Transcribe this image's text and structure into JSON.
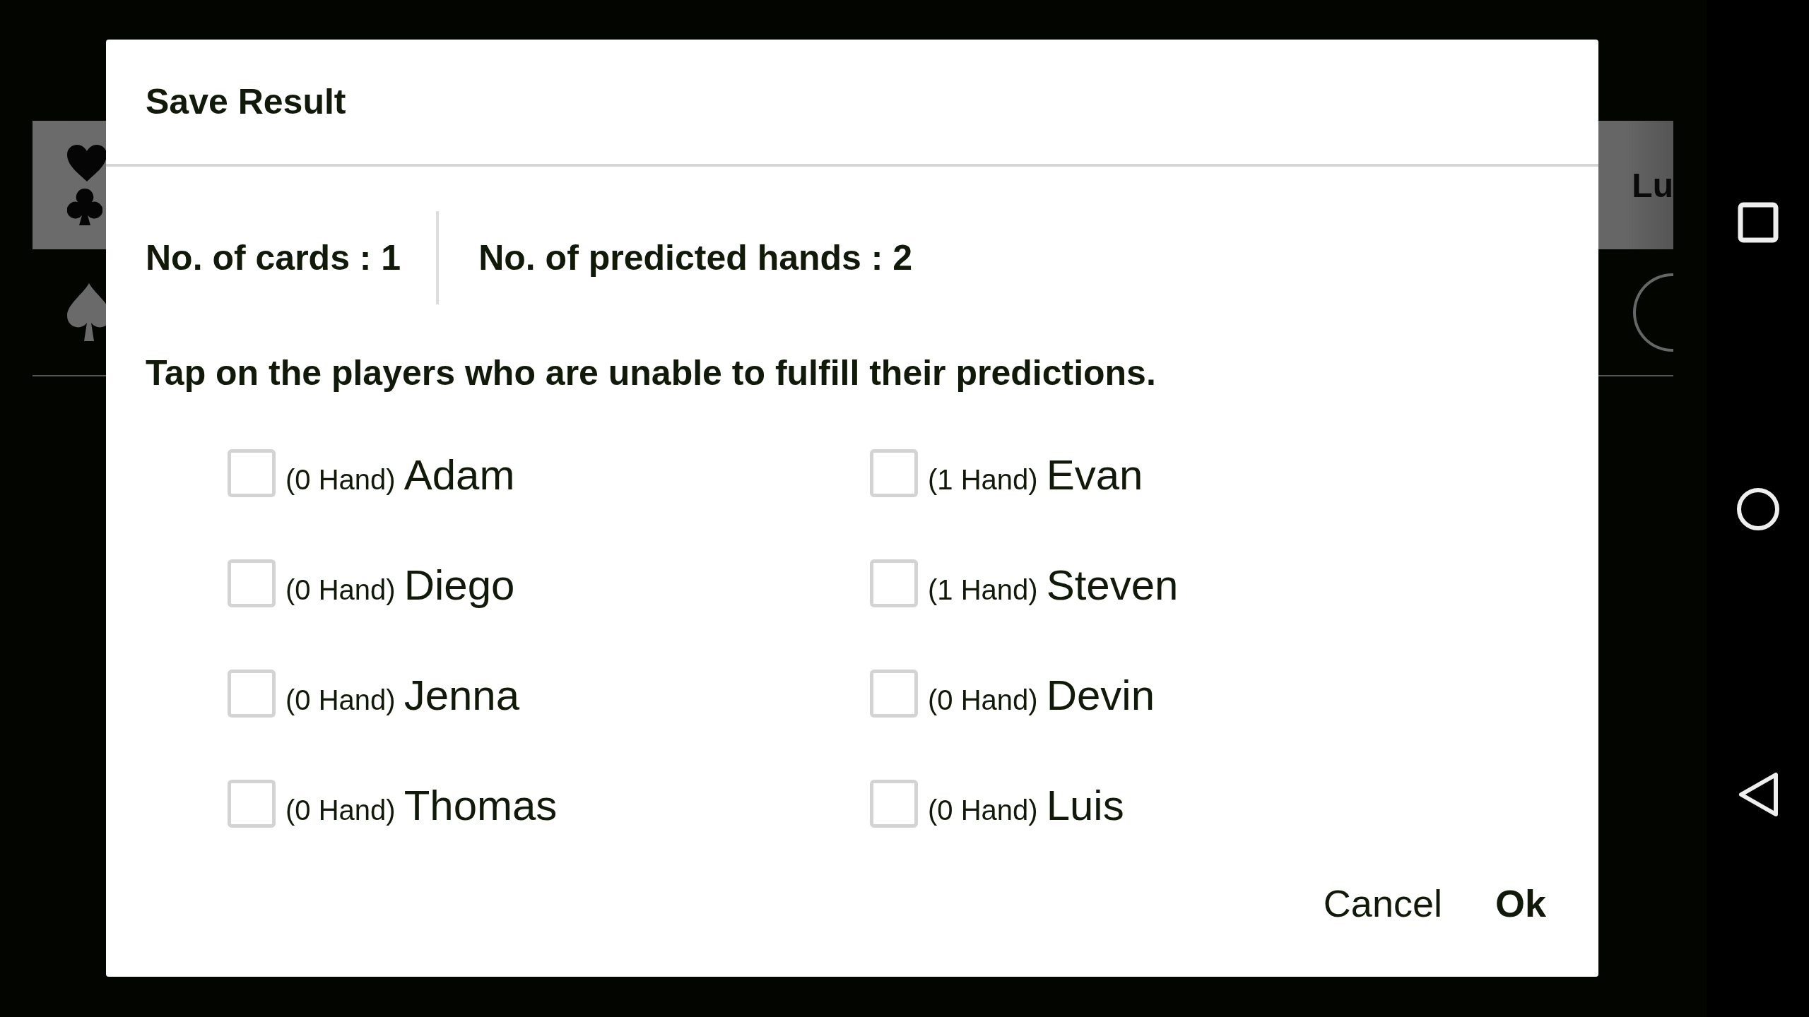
{
  "background": {
    "header_text": "Lu"
  },
  "dialog": {
    "title": "Save Result",
    "stats": [
      "No. of cards : 1",
      "No. of predicted hands : 2"
    ],
    "instruction": "Tap on the players who are unable to fulfill their predictions.",
    "players": [
      {
        "hands": "(0 Hand)",
        "name": "Adam",
        "checked": false
      },
      {
        "hands": "(1 Hand)",
        "name": "Evan",
        "checked": false
      },
      {
        "hands": "(0 Hand)",
        "name": "Diego",
        "checked": false
      },
      {
        "hands": "(1 Hand)",
        "name": "Steven",
        "checked": false
      },
      {
        "hands": "(0 Hand)",
        "name": "Jenna",
        "checked": false
      },
      {
        "hands": "(0 Hand)",
        "name": "Devin",
        "checked": false
      },
      {
        "hands": "(0 Hand)",
        "name": "Thomas",
        "checked": false
      },
      {
        "hands": "(0 Hand)",
        "name": "Luis",
        "checked": false
      }
    ],
    "buttons": [
      {
        "label": "Cancel",
        "kind": "secondary"
      },
      {
        "label": "Ok",
        "kind": "primary"
      }
    ]
  }
}
